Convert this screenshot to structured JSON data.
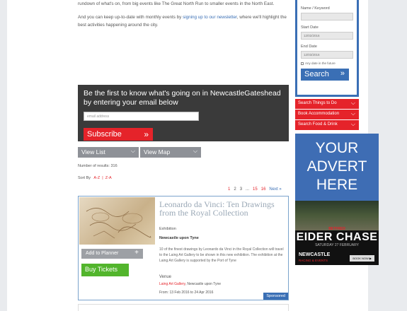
{
  "intro": {
    "line1": "rundown of what's on, from big events like The Great North Run to smaller events in the North East.",
    "line2_pre": "And you can keep up-to-date with monthly events by ",
    "line2_link": "signing up to our newsletter",
    "line2_post": ", where we'll highlight the best activities happening around the city."
  },
  "signup": {
    "title": "Be the first to know what's going on in NewcastleGateshead by entering your email below",
    "email_placeholder": "email address",
    "button_label": "Subscribe",
    "button_arrow": "»"
  },
  "tabs": [
    {
      "label": "View List",
      "chevron": "⌵"
    },
    {
      "label": "View Map",
      "chevron": "⌵"
    }
  ],
  "results": {
    "label": "Number of results: 316"
  },
  "sort": {
    "label": "Sort By",
    "az": "A-Z",
    "sep": "|",
    "za": "Z-A"
  },
  "pager": {
    "p1": "1",
    "p2": "2",
    "p3": "3",
    "dots": "...",
    "p15": "15",
    "p16": "16",
    "next": "Next »"
  },
  "card": {
    "title": "Leonardo da Vinci: Ten Drawings from the Royal Collection",
    "category": "Exhibition",
    "location": "Newcastle upon Tyne",
    "description": "10 of the finest drawings by Leonardo da Vinci in the Royal Collection will travel to the Laing Art Gallery to be shown in this new exhibition. The exhibition at the Laing Art Gallery is supported by the Port of Tyne",
    "venue_heading": "Venue",
    "venue_name": "Laing Art Gallery",
    "venue_city": ", Newcastle upon Tyne",
    "dates": "From: 13 Feb 2016 to 24 Apr 2016",
    "planner_label": "Add to Planner",
    "planner_plus": "+",
    "buy_label": "Buy Tickets",
    "sponsored": "Sponsored"
  },
  "search": {
    "name_label": "Name / Keyword",
    "name_value": "",
    "start_label": "Start Date",
    "start_value": "12/02/2016",
    "end_label": "End Date",
    "end_value": "12/03/2016",
    "any_date": "Any date in the future",
    "button_label": "Search",
    "button_arrow": "»"
  },
  "side_buttons": [
    {
      "label": "Search Things to Do",
      "chevron": "⌵"
    },
    {
      "label": "Book Accommodation",
      "chevron": "⌵"
    },
    {
      "label": "Search Food & Drink",
      "chevron": "⌵"
    }
  ],
  "advert": {
    "line1": "YOUR",
    "line2": "ADVERT",
    "line3": "HERE",
    "betfred": "BETFRED",
    "event": "EIDER CHASE",
    "date": "SATURDAY 27 FEBRUARY",
    "brand": "NEWCASTLE",
    "tagline": "RACING & EVENTS",
    "book": "BOOK NOW ▶"
  },
  "colors": {
    "accent_red": "#e5232a",
    "accent_blue": "#3a6fb5",
    "buy_green": "#52b52c"
  }
}
